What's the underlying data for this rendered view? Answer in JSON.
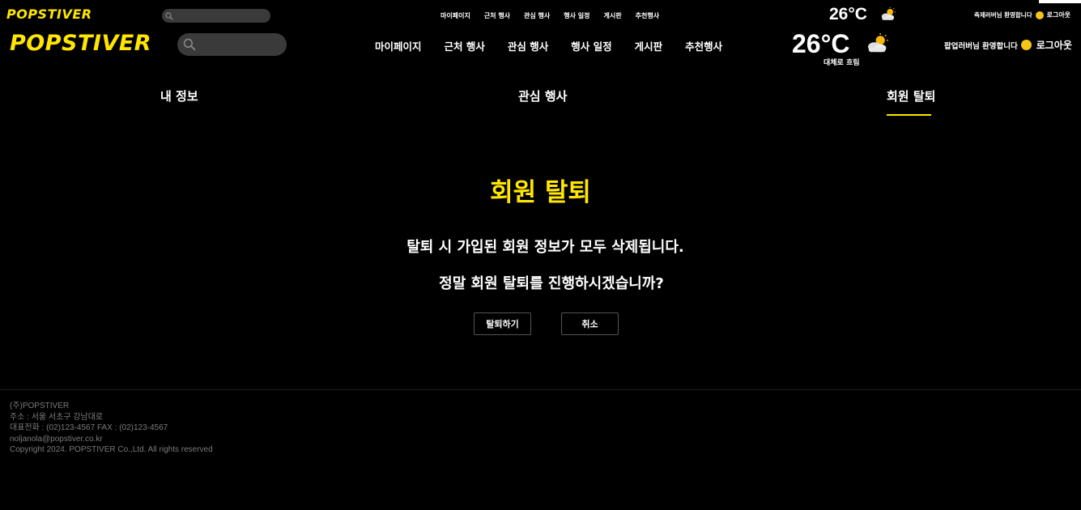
{
  "brand": {
    "name": "POPSTIVER",
    "accent_color": "#ffe600"
  },
  "search": {
    "placeholder": "",
    "icon": "search-icon"
  },
  "nav": {
    "items": [
      {
        "label": "마이페이지"
      },
      {
        "label": "근처 행사"
      },
      {
        "label": "관심 행사"
      },
      {
        "label": "행사 일정"
      },
      {
        "label": "게시판"
      },
      {
        "label": "추천행사"
      }
    ]
  },
  "weather": {
    "temperature": "26°C",
    "description": "대체로 흐림",
    "icon": "partly-cloudy-icon"
  },
  "user": {
    "greeting": "팝업러버님 환영합니다",
    "greeting_small": "축제러버님 환영합니다",
    "emoji_icon": "smile-icon",
    "logout_label": "로그아웃"
  },
  "tabs": [
    {
      "label": "내 정보",
      "active": false
    },
    {
      "label": "관심 행사",
      "active": false
    },
    {
      "label": "회원 탈퇴",
      "active": true
    }
  ],
  "main": {
    "title": "회원 탈퇴",
    "message_1": "탈퇴 시 가입된 회원 정보가 모두 삭제됩니다.",
    "message_2": "정말 회원 탈퇴를 진행하시겠습니까?",
    "confirm_label": "탈퇴하기",
    "cancel_label": "취소"
  },
  "footer": {
    "company": "(주)POPSTIVER",
    "address": "주소 : 서울 서초구 강남대로",
    "phone": "대표전화 : (02)123-4567 FAX : (02)123-4567",
    "email": "noljanola@popstiver.co.kr",
    "copyright": "Copyright 2024. POPSTIVER Co.,Ltd. All rights reserved"
  }
}
